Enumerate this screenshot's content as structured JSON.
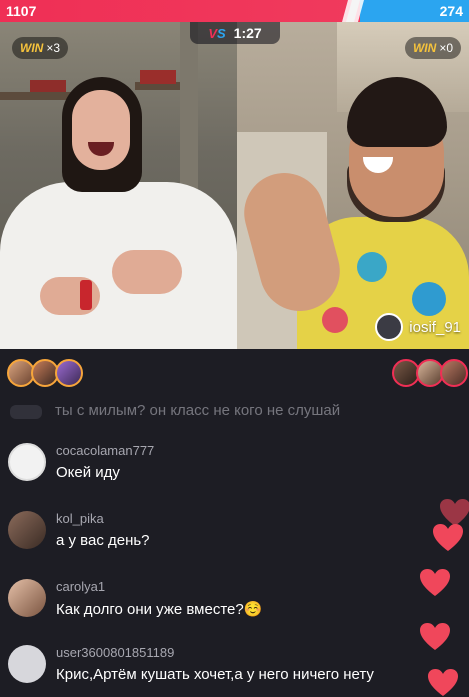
{
  "score": {
    "left": "1107",
    "right": "274"
  },
  "battle": {
    "vs_left": "V",
    "vs_right": "S",
    "timer": "1:27"
  },
  "badges": {
    "left": {
      "win": "WIN",
      "count": "×3"
    },
    "right": {
      "win": "WIN",
      "count": "×0"
    }
  },
  "opponent": {
    "username": "iosif_91"
  },
  "comments": {
    "faded_text": "ты с милым? он класс не кого не слушай",
    "items": [
      {
        "user": "cocacolaman777",
        "text": "Окей иду"
      },
      {
        "user": "kol_pika",
        "text": "а у вас день?"
      },
      {
        "user": "carolya1",
        "text": "Как долго они уже вместе?☺️"
      },
      {
        "user": "user3600801851189",
        "text": "Крис,Артём кушать хочет,а у него ничего нету"
      }
    ]
  },
  "colors": {
    "team_left": "#ef2f55",
    "team_right": "#2ba5f0",
    "heart": "#f0475b",
    "win_gold": "#f6c33c"
  }
}
